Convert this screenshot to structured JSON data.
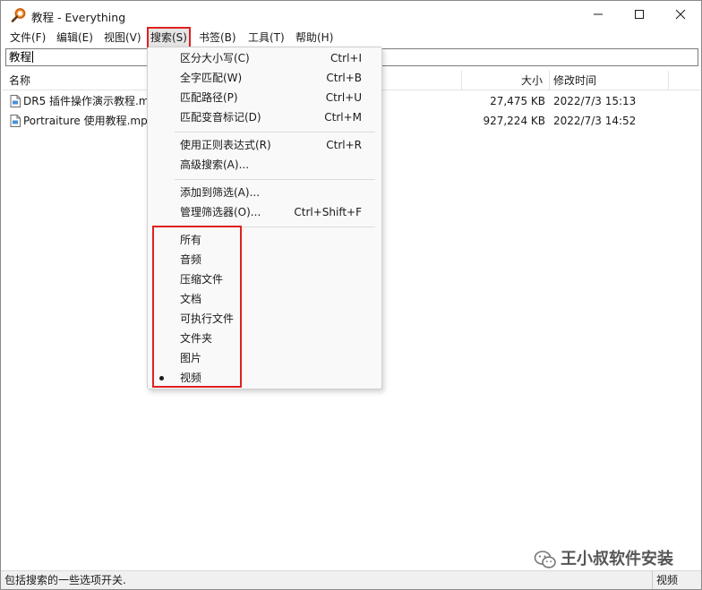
{
  "window": {
    "title": "教程 - Everything"
  },
  "menubar": {
    "items": [
      {
        "label": "文件(F)"
      },
      {
        "label": "编辑(E)"
      },
      {
        "label": "视图(V)"
      },
      {
        "label": "搜索(S)"
      },
      {
        "label": "书签(B)"
      },
      {
        "label": "工具(T)"
      },
      {
        "label": "帮助(H)"
      }
    ]
  },
  "search": {
    "value": "教程"
  },
  "list": {
    "columns": {
      "name": "名称",
      "size": "大小",
      "modified": "修改时间"
    },
    "rows": [
      {
        "name": "DR5 插件操作演示教程.m",
        "size": "27,475 KB",
        "modified": "2022/7/3 15:13"
      },
      {
        "name": "Portraiture 使用教程.mp",
        "size": "927,224 KB",
        "modified": "2022/7/3 14:52"
      }
    ]
  },
  "search_menu": {
    "options": [
      {
        "label": "区分大小写(C)",
        "shortcut": "Ctrl+I"
      },
      {
        "label": "全字匹配(W)",
        "shortcut": "Ctrl+B"
      },
      {
        "label": "匹配路径(P)",
        "shortcut": "Ctrl+U"
      },
      {
        "label": "匹配变音标记(D)",
        "shortcut": "Ctrl+M"
      }
    ],
    "advanced": [
      {
        "label": "使用正则表达式(R)",
        "shortcut": "Ctrl+R"
      },
      {
        "label": "高级搜索(A)...",
        "shortcut": ""
      }
    ],
    "filter_actions": [
      {
        "label": "添加到筛选(A)...",
        "shortcut": ""
      },
      {
        "label": "管理筛选器(O)...",
        "shortcut": "Ctrl+Shift+F"
      }
    ],
    "filters": [
      {
        "label": "所有"
      },
      {
        "label": "音频"
      },
      {
        "label": "压缩文件"
      },
      {
        "label": "文档"
      },
      {
        "label": "可执行文件"
      },
      {
        "label": "文件夹"
      },
      {
        "label": "图片"
      },
      {
        "label": "视频"
      }
    ],
    "selected_filter": "视频"
  },
  "statusbar": {
    "hint": "包括搜索的一些选项开关.",
    "filter": "视频"
  },
  "watermark": {
    "text": "王小叔软件安装"
  },
  "colors": {
    "highlight": "#e02020",
    "app_icon": "#e8731a"
  }
}
